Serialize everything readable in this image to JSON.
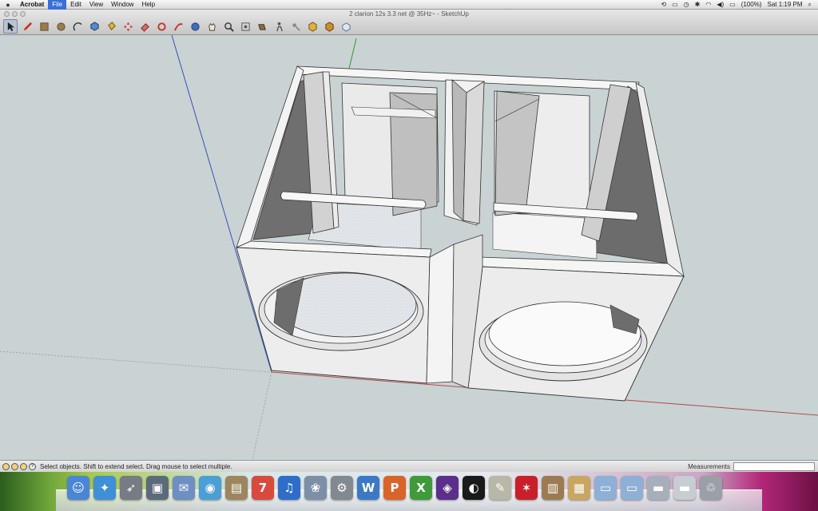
{
  "menubar": {
    "app_name": "Acrobat",
    "menus": [
      "File",
      "Edit",
      "View",
      "Window",
      "Help"
    ],
    "active_menu": "File",
    "status": {
      "battery": "(100%)",
      "clock": "Sat 1:19 PM"
    }
  },
  "window": {
    "title": "2 clarion 12s 3.3 net @ 35Hz~ - SketchUp"
  },
  "toolbar": {
    "tools": [
      "select-tool",
      "pencil-tool",
      "rectangle-tool",
      "circle-tool",
      "arc-tool",
      "push-pull-tool",
      "paint-bucket-tool",
      "move-tool",
      "eraser-tool",
      "rotate-tool",
      "follow-me-tool",
      "orbit-tool",
      "pan-tool",
      "zoom-tool",
      "zoom-extents-tool",
      "previous-view-tool",
      "walk-tool",
      "position-camera-tool",
      "get-models-tool",
      "share-model-tool",
      "component-tool"
    ],
    "selected_tool": "select-tool"
  },
  "statusbar": {
    "hint": "Select objects. Shift to extend select. Drag mouse to select multiple.",
    "measurements_label": "Measurements",
    "measurements_value": ""
  },
  "dock": {
    "apps": [
      {
        "name": "finder",
        "glyph": "☺",
        "color": "#4a86d8"
      },
      {
        "name": "safari",
        "glyph": "✦",
        "color": "#3f8fd6"
      },
      {
        "name": "rocket",
        "glyph": "➶",
        "color": "#777b82"
      },
      {
        "name": "photo-booth",
        "glyph": "▣",
        "color": "#5b6b7a"
      },
      {
        "name": "mail",
        "glyph": "✉",
        "color": "#6d8fc2"
      },
      {
        "name": "ichat",
        "glyph": "◉",
        "color": "#4aa0d4"
      },
      {
        "name": "address-book",
        "glyph": "▤",
        "color": "#9c8660"
      },
      {
        "name": "ical",
        "glyph": "7",
        "color": "#d94a3e"
      },
      {
        "name": "itunes",
        "glyph": "♫",
        "color": "#2e6ec9"
      },
      {
        "name": "iphoto",
        "glyph": "❀",
        "color": "#7d8fa6"
      },
      {
        "name": "system-preferences",
        "glyph": "⚙",
        "color": "#828990"
      },
      {
        "name": "word",
        "glyph": "W",
        "color": "#3b79c6"
      },
      {
        "name": "powerpoint",
        "glyph": "P",
        "color": "#d8642a"
      },
      {
        "name": "excel",
        "glyph": "X",
        "color": "#3f9b3a"
      },
      {
        "name": "pro-tools",
        "glyph": "◈",
        "color": "#5b2f8a"
      },
      {
        "name": "live",
        "glyph": "◐",
        "color": "#1a1a1a"
      },
      {
        "name": "text-edit",
        "glyph": "✎",
        "color": "#b8b7a8"
      },
      {
        "name": "acrobat",
        "glyph": "✶",
        "color": "#c8202a"
      },
      {
        "name": "preview",
        "glyph": "▥",
        "color": "#9d7b52"
      },
      {
        "name": "installer",
        "glyph": "▦",
        "color": "#c9a662"
      },
      {
        "name": "folder-applications",
        "glyph": "▭",
        "color": "#8fb0d6"
      },
      {
        "name": "folder-documents",
        "glyph": "▭",
        "color": "#8fb0d6"
      },
      {
        "name": "downloads-stack",
        "glyph": "▬",
        "color": "#a7b0ba"
      },
      {
        "name": "desktop-stack",
        "glyph": "▬",
        "color": "#c7cdd3"
      },
      {
        "name": "trash",
        "glyph": "♲",
        "color": "#9aa0a6"
      }
    ]
  }
}
